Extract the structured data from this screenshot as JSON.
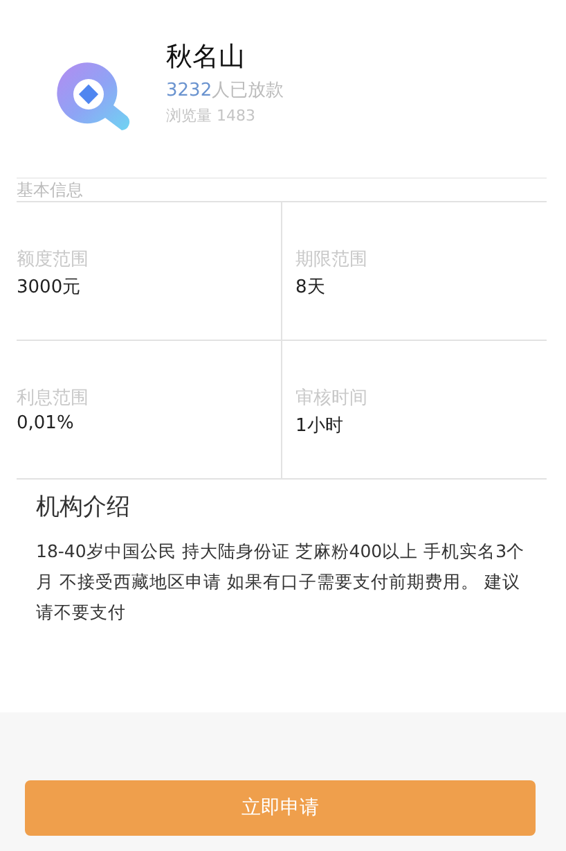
{
  "header": {
    "name": "秋名山",
    "lent_count": "3232",
    "lent_suffix": "人已放款",
    "views": "浏览量 1483"
  },
  "basic_info": {
    "title": "基本信息",
    "items": [
      {
        "label": "额度范围",
        "value": "3000元"
      },
      {
        "label": "期限范围",
        "value": "8天"
      },
      {
        "label": "利息范围",
        "value": "0,01%"
      },
      {
        "label": "审核时间",
        "value": "1小时"
      }
    ]
  },
  "intro": {
    "title": "机构介绍",
    "text": "18-40岁中国公民 持大陆身份证 芝麻粉400以上 手机实名3个月 不接受西藏地区申请 如果有口子需要支付前期费用。 建议请不要支付"
  },
  "apply_button": "立即申请"
}
